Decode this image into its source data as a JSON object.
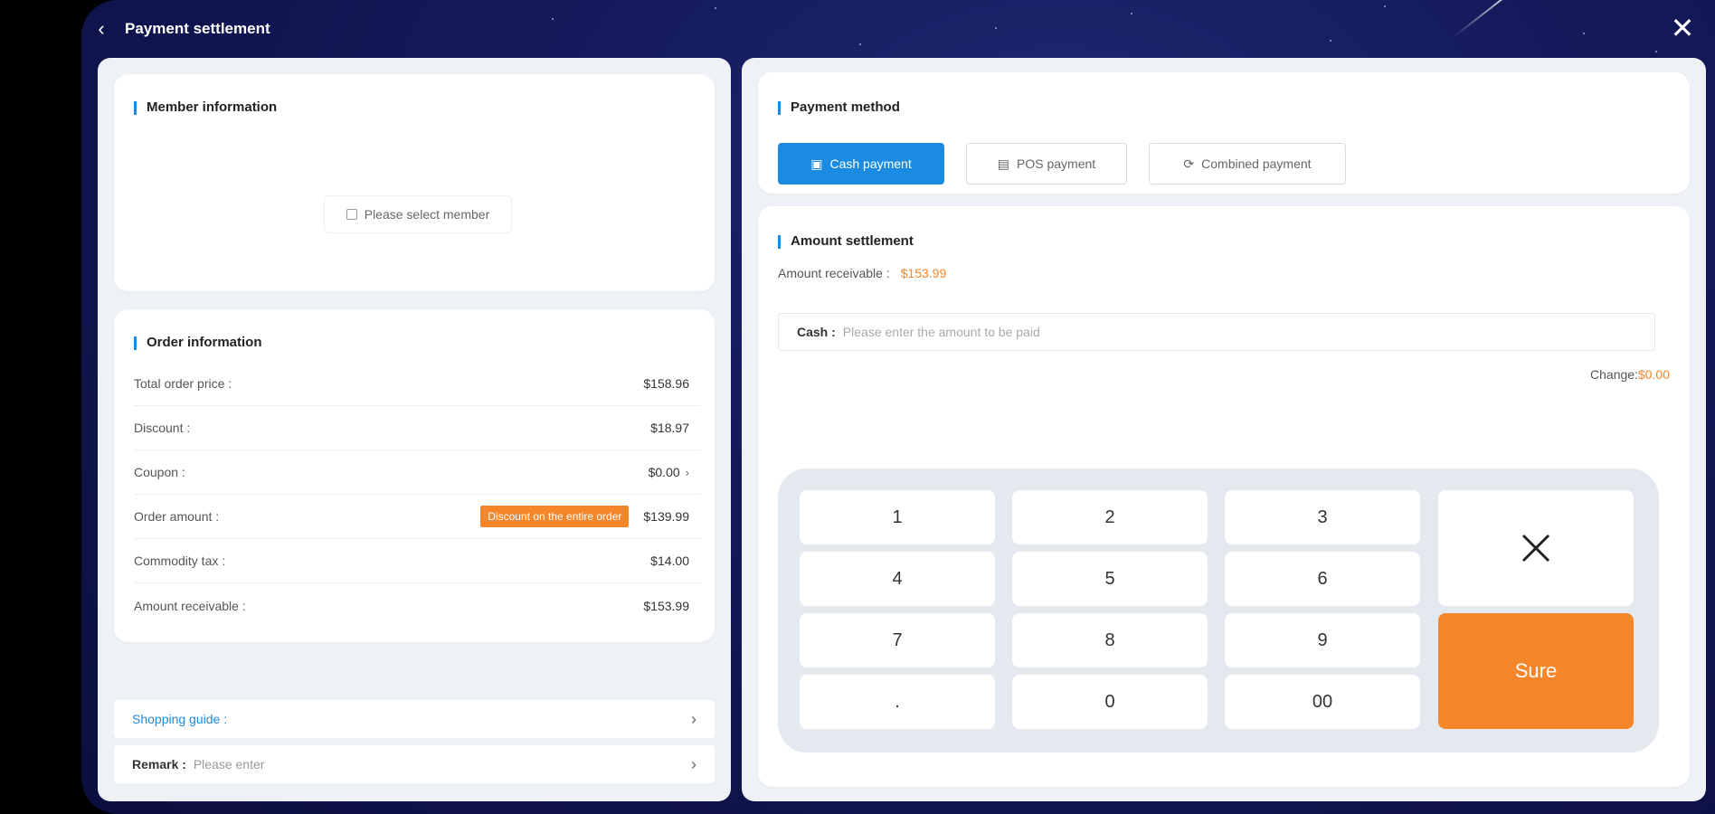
{
  "title": "Payment settlement",
  "member": {
    "section_title": "Member information",
    "select_label": "Please select member"
  },
  "order": {
    "section_title": "Order information",
    "rows": [
      {
        "label": "Total order price :",
        "value": "$158.96"
      },
      {
        "label": "Discount :",
        "value": "$18.97"
      },
      {
        "label": "Coupon :",
        "value": "$0.00"
      },
      {
        "label": "Order amount :",
        "value": "$139.99",
        "badge": "Discount on the entire order"
      },
      {
        "label": "Commodity tax :",
        "value": "$14.00"
      },
      {
        "label": "Amount receivable :",
        "value": "$153.99"
      }
    ]
  },
  "guide": {
    "label": "Shopping guide :"
  },
  "remark": {
    "label": "Remark :",
    "placeholder": "Please enter"
  },
  "payment": {
    "section_title": "Payment method",
    "methods": [
      {
        "label": "Cash payment",
        "icon": "cash-icon",
        "active": true
      },
      {
        "label": "POS payment",
        "icon": "pos-icon",
        "active": false
      },
      {
        "label": "Combined payment",
        "icon": "combined-icon",
        "active": false
      }
    ]
  },
  "settlement": {
    "section_title": "Amount settlement",
    "receivable_label": "Amount receivable :",
    "receivable_value": "$153.99",
    "cash_label": "Cash :",
    "cash_placeholder": "Please enter the amount to be paid",
    "change_label": "Change:",
    "change_value": "$0.00"
  },
  "keypad": {
    "keys": [
      "1",
      "2",
      "3",
      "4",
      "5",
      "6",
      "7",
      "8",
      "9",
      ".",
      "0",
      "00"
    ],
    "sure_label": "Sure"
  },
  "colors": {
    "accent": "#1a8be0",
    "orange": "#f5862a"
  }
}
